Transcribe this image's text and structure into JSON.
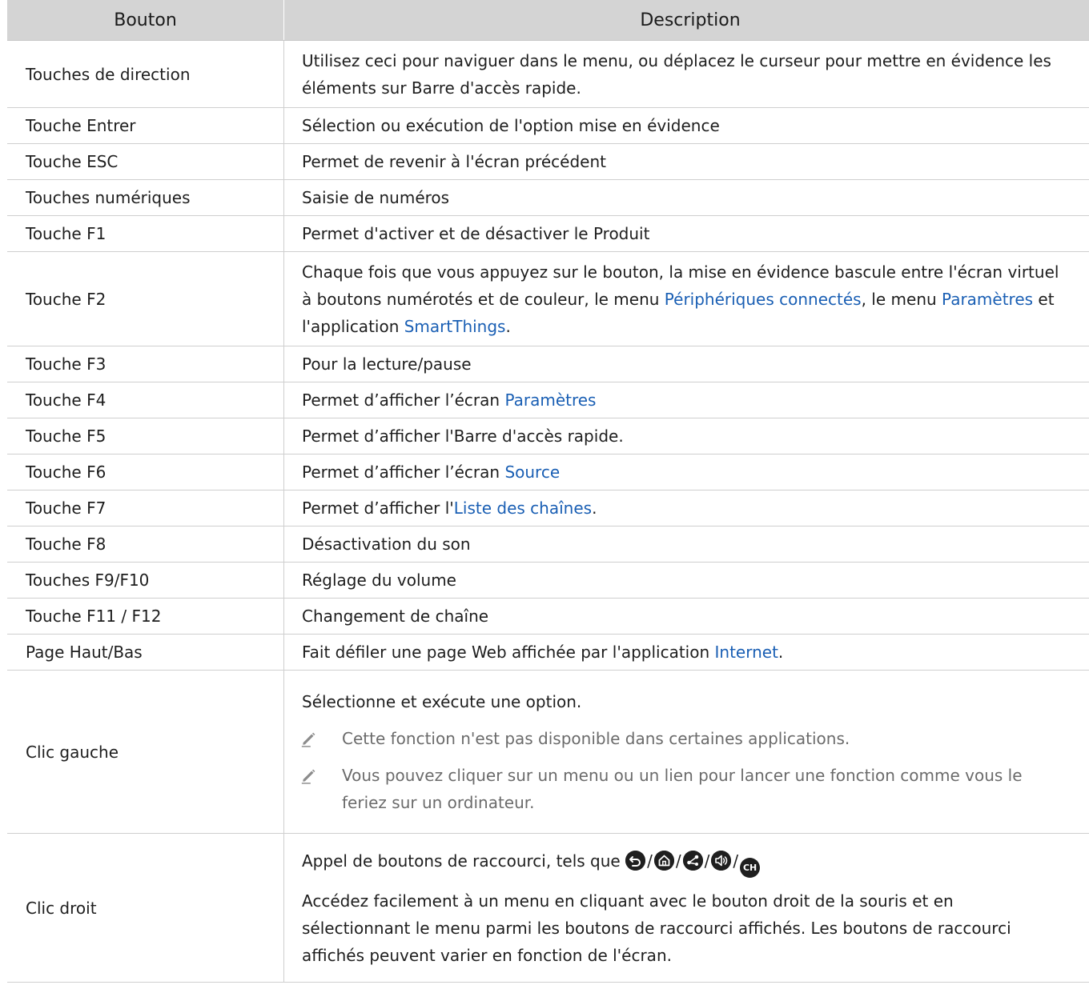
{
  "table": {
    "headers": [
      "Bouton",
      "Description"
    ],
    "rows": [
      {
        "key": "Touches de direction",
        "desc": "Utilisez ceci pour naviguer dans le menu, ou déplacez le curseur pour mettre en évidence les éléments sur Barre d'accès rapide."
      },
      {
        "key": "Touche Entrer",
        "desc": "Sélection ou exécution de l'option mise en évidence"
      },
      {
        "key": "Touche ESC",
        "desc": "Permet de revenir à l'écran précédent"
      },
      {
        "key": "Touches numériques",
        "desc": "Saisie de numéros"
      },
      {
        "key": "Touche F1",
        "desc": "Permet d'activer et de désactiver le Produit"
      },
      {
        "key": "Touche F2",
        "desc_parts": [
          "Chaque fois que vous appuyez sur le bouton, la mise en évidence bascule entre l'écran virtuel à boutons numérotés et de couleur, le menu ",
          "Périphériques connectés",
          ", le menu ",
          "Paramètres",
          " et l'application ",
          "SmartThings",
          "."
        ]
      },
      {
        "key": "Touche F3",
        "desc": "Pour la lecture/pause"
      },
      {
        "key": "Touche F4",
        "desc_parts": [
          "Permet d’afficher l’écran ",
          "Paramètres"
        ]
      },
      {
        "key": "Touche F5",
        "desc": "Permet d’afficher l'Barre d'accès rapide."
      },
      {
        "key": "Touche F6",
        "desc_parts": [
          "Permet d’afficher l’écran ",
          "Source"
        ]
      },
      {
        "key": "Touche F7",
        "desc_parts": [
          "Permet d’afficher l'",
          "Liste des chaînes",
          "."
        ]
      },
      {
        "key": "Touche F8",
        "desc": "Désactivation du son"
      },
      {
        "key": "Touches F9/F10",
        "desc": "Réglage du volume"
      },
      {
        "key": "Touche F11 / F12",
        "desc": "Changement de chaîne"
      },
      {
        "key": "Page Haut/Bas",
        "desc_parts": [
          "Fait défiler une page Web affichée par l'application ",
          "Internet",
          "."
        ]
      },
      {
        "key": "Clic gauche",
        "desc": "Sélectionne et exécute une option.",
        "notes": [
          "Cette fonction n'est pas disponible dans certaines applications.",
          "Vous pouvez cliquer sur un menu ou un lien pour lancer une fonction comme vous le feriez sur un ordinateur."
        ]
      },
      {
        "key": "Clic droit",
        "desc": "Appel de boutons de raccourci, tels que",
        "separator": "/",
        "shortcut_icons": [
          "back-icon",
          "home-icon",
          "share-icon",
          "volume-icon",
          "channel-icon"
        ],
        "channel_icon_text": "CH",
        "extra": "Accédez facilement à un menu en cliquant avec le bouton droit de la souris et en sélectionnant le menu parmi les boutons de raccourci affichés. Les boutons de raccourci affichés peuvent varier en fonction de l'écran."
      }
    ]
  },
  "colors": {
    "header_bg": "#d4d4d4",
    "link": "#1a5fb4",
    "note_text": "#6b6b6b"
  }
}
